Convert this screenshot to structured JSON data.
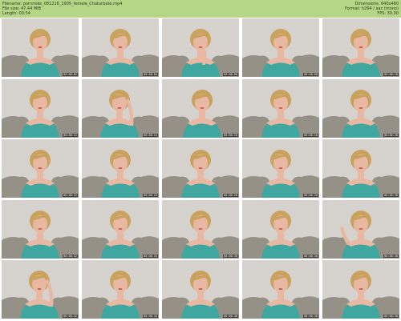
{
  "header": {
    "filename_label": "Filename:",
    "filename": "pornmike_081216_1905_female_Chaturbate.mp4",
    "filesize_label": "File size:",
    "filesize": "47.44 MiB",
    "length_label": "Length:",
    "length": "00:54",
    "dimensions_label": "Dimensions:",
    "dimensions": "640x480",
    "format_label": "Format:",
    "format": "h264 / aac (mono)",
    "fps_label": "FPS:",
    "fps": "30.00"
  },
  "colors": {
    "header_bg": "#b5d686",
    "header_text": "#2d3a1a",
    "wall": "#d6d3cf",
    "couch": "#8b8579",
    "top": "#3fa7a0",
    "skin": "#e8b8a2",
    "hair": "#c9a25e"
  },
  "thumbnails": [
    {
      "time": "00:00:02",
      "pose": "center"
    },
    {
      "time": "00:00:04",
      "pose": "center"
    },
    {
      "time": "00:00:06",
      "pose": "hand-chin"
    },
    {
      "time": "00:00:08",
      "pose": "center"
    },
    {
      "time": "00:00:10",
      "pose": "center"
    },
    {
      "time": "00:00:12",
      "pose": "center"
    },
    {
      "time": "00:00:14",
      "pose": "hand-hair"
    },
    {
      "time": "00:00:16",
      "pose": "tilt"
    },
    {
      "time": "00:00:18",
      "pose": "center"
    },
    {
      "time": "00:00:20",
      "pose": "center"
    },
    {
      "time": "00:00:22",
      "pose": "center"
    },
    {
      "time": "00:00:24",
      "pose": "center"
    },
    {
      "time": "00:00:26",
      "pose": "center"
    },
    {
      "time": "00:00:28",
      "pose": "center"
    },
    {
      "time": "00:00:30",
      "pose": "center"
    },
    {
      "time": "00:00:32",
      "pose": "center"
    },
    {
      "time": "00:00:34",
      "pose": "center"
    },
    {
      "time": "00:00:36",
      "pose": "center"
    },
    {
      "time": "00:00:38",
      "pose": "center"
    },
    {
      "time": "00:00:40",
      "pose": "wave"
    },
    {
      "time": "00:00:42",
      "pose": "hand-hair"
    },
    {
      "time": "00:00:44",
      "pose": "center"
    },
    {
      "time": "00:00:46",
      "pose": "center"
    },
    {
      "time": "00:00:48",
      "pose": "center"
    },
    {
      "time": "00:00:50",
      "pose": "center"
    }
  ]
}
